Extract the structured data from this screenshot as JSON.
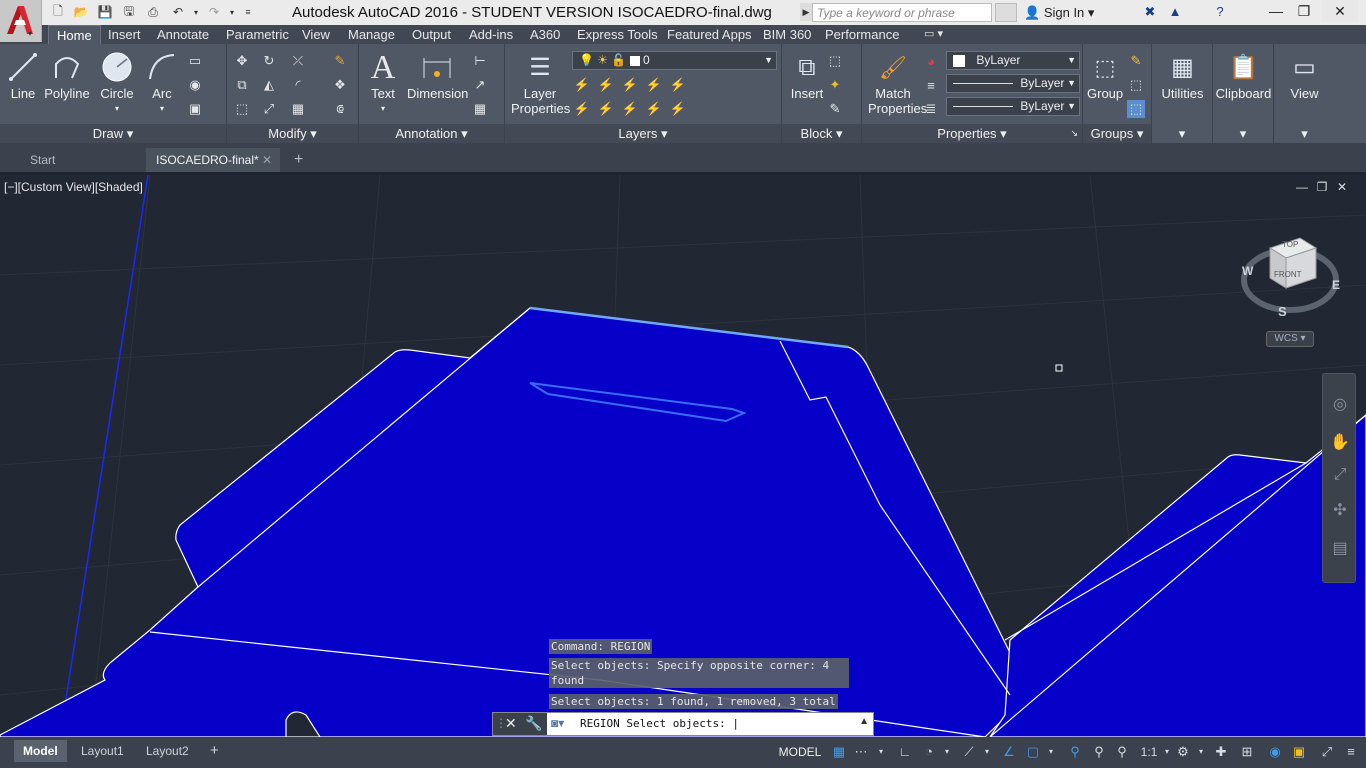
{
  "titlebar": {
    "title": "Autodesk AutoCAD 2016 - STUDENT VERSION    ISOCAEDRO-final.dwg",
    "search_placeholder": "Type a keyword or phrase",
    "signin": "Sign In",
    "minimize": "—",
    "restore": "❐",
    "close": "✕"
  },
  "ribbon_tabs": [
    "Home",
    "Insert",
    "Annotate",
    "Parametric",
    "View",
    "Manage",
    "Output",
    "Add-ins",
    "A360",
    "Express Tools",
    "Featured Apps",
    "BIM 360",
    "Performance"
  ],
  "panels": {
    "draw": {
      "title": "Draw",
      "line": "Line",
      "polyline": "Polyline",
      "circle": "Circle",
      "arc": "Arc"
    },
    "modify": {
      "title": "Modify"
    },
    "annotation": {
      "title": "Annotation",
      "text": "Text",
      "dimension": "Dimension"
    },
    "layers": {
      "title": "Layers",
      "layer_properties_1": "Layer",
      "layer_properties_2": "Properties",
      "current_layer": "0"
    },
    "block": {
      "title": "Block",
      "insert": "Insert"
    },
    "properties": {
      "title": "Properties",
      "match_1": "Match",
      "match_2": "Properties",
      "color": "ByLayer",
      "linetype": "ByLayer",
      "lineweight": "ByLayer"
    },
    "groups": {
      "title": "Groups",
      "group": "Group"
    },
    "utilities": {
      "label": "Utilities"
    },
    "clipboard": {
      "label": "Clipboard"
    },
    "view": {
      "label": "View"
    }
  },
  "file_tabs": {
    "start": "Start",
    "active": "ISOCAEDRO-final*",
    "close": "✕",
    "add": "+"
  },
  "viewport": {
    "label": "[−][Custom View][Shaded]",
    "viewcube": {
      "top": "TOP",
      "front": "FRONT",
      "w": "W",
      "e": "E",
      "s": "S"
    },
    "wcs": "WCS ▾"
  },
  "command": {
    "history": [
      "Command: REGION",
      "Select objects: Specify opposite corner: 4 found",
      "Select objects: 1 found, 1 removed, 3 total"
    ],
    "prompt": "REGION Select objects: |"
  },
  "statusbar": {
    "layout_tabs": [
      "Model",
      "Layout1",
      "Layout2"
    ],
    "add": "+",
    "model_space": "MODEL",
    "scale": "1:1"
  },
  "colors": {
    "region_fill": "#0600c8",
    "viewport_bg": "#212833",
    "ribbon": "#4f5864",
    "accent": "#3d9cf0"
  }
}
